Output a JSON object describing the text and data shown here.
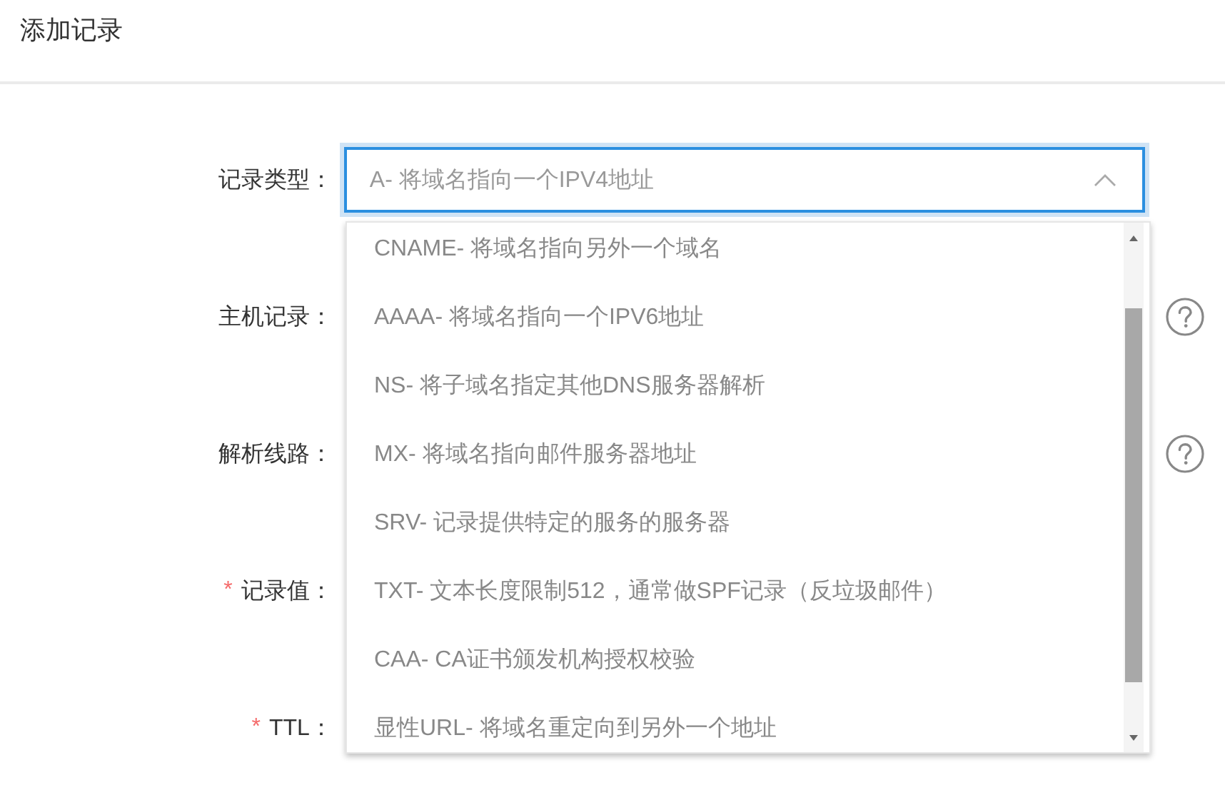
{
  "title": "添加记录",
  "fields": [
    {
      "label": "记录类型：",
      "help": false
    },
    {
      "label": "主机记录：",
      "help": true
    },
    {
      "label": "解析线路：",
      "help": true
    },
    {
      "label": "记录值：",
      "required_mark": "*",
      "help": false
    },
    {
      "label": "TTL：",
      "required_mark": "*",
      "help": false
    }
  ],
  "record_type": {
    "value": "A- 将域名指向一个IPV4地址",
    "expanded": true,
    "options": [
      "CNAME- 将域名指向另外一个域名",
      "AAAA- 将域名指向一个IPV6地址",
      "NS- 将子域名指定其他DNS服务器解析",
      "MX- 将域名指向邮件服务器地址",
      "SRV- 记录提供特定的服务的服务器",
      "TXT- 文本长度限制512，通常做SPF记录（反垃圾邮件）",
      "CAA- CA证书颁发机构授权校验",
      "显性URL- 将域名重定向到另外一个地址"
    ]
  }
}
